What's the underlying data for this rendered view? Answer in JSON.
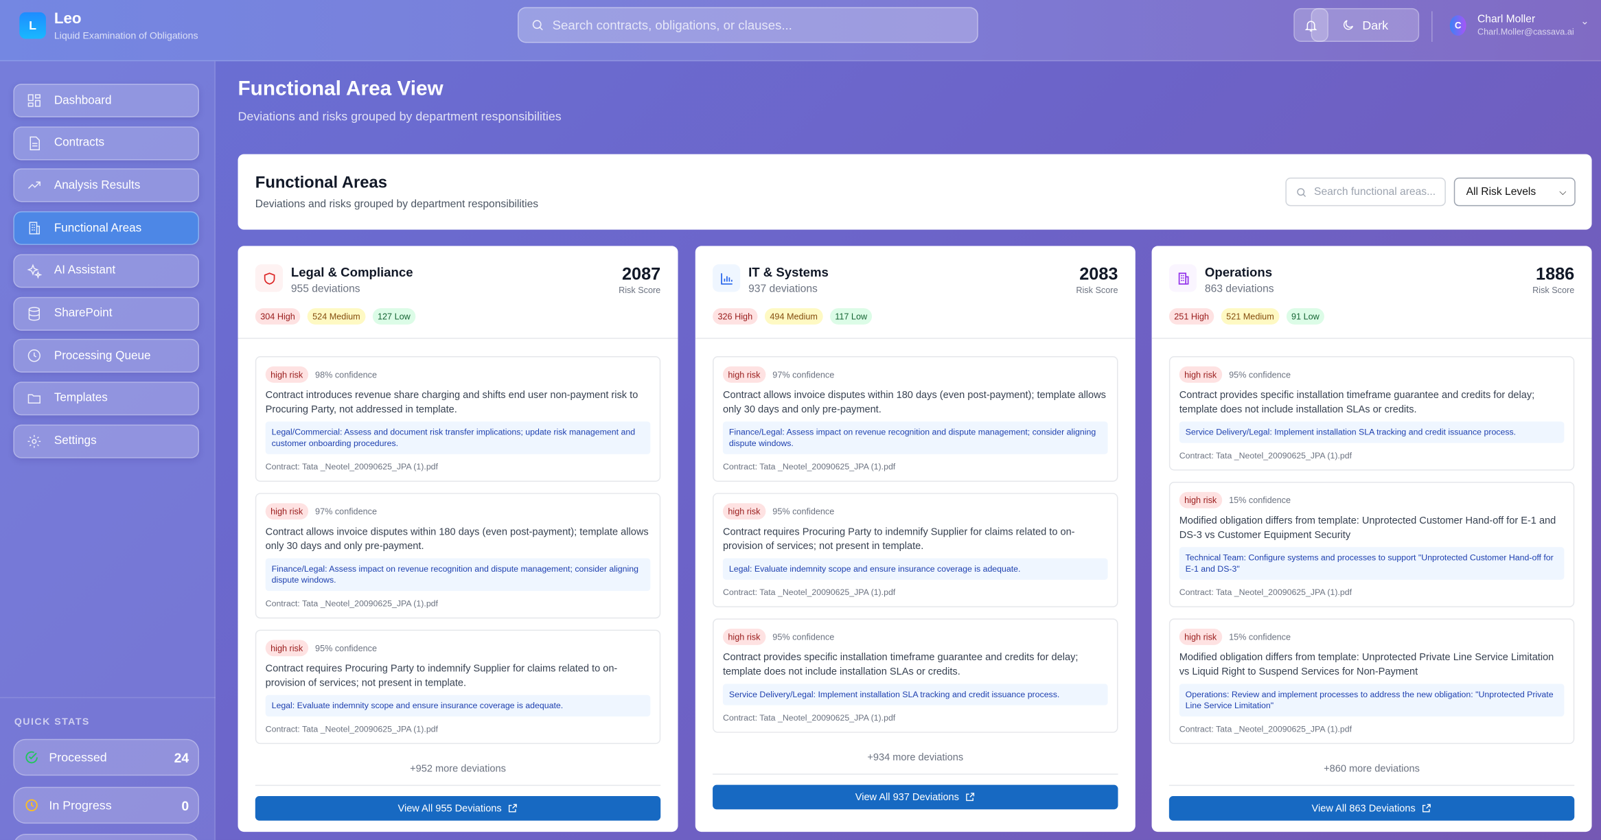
{
  "header": {
    "logo_letter": "L",
    "app_name": "Leo",
    "app_subtitle": "Liquid Examination of Obligations",
    "search_placeholder": "Search contracts, obligations, or clauses...",
    "theme_label": "Dark",
    "user_initial": "C",
    "user_name": "Charl Moller",
    "user_email": "Charl.Moller@cassava.ai"
  },
  "sidebar": {
    "items": [
      {
        "label": "Dashboard"
      },
      {
        "label": "Contracts"
      },
      {
        "label": "Analysis Results"
      },
      {
        "label": "Functional Areas"
      },
      {
        "label": "AI Assistant"
      },
      {
        "label": "SharePoint"
      },
      {
        "label": "Processing Queue"
      },
      {
        "label": "Templates"
      },
      {
        "label": "Settings"
      }
    ],
    "quick_stats_label": "QUICK STATS",
    "stats": [
      {
        "label": "Processed",
        "value": "24"
      },
      {
        "label": "In Progress",
        "value": "0"
      }
    ]
  },
  "page": {
    "title": "Functional Area View",
    "subtitle": "Deviations and risks grouped by department responsibilities"
  },
  "panel": {
    "title": "Functional Areas",
    "subtitle": "Deviations and risks grouped by department responsibilities",
    "search_placeholder": "Search functional areas...",
    "risk_filter": "All Risk Levels"
  },
  "areas": [
    {
      "name": "Legal & Compliance",
      "deviations": "955 deviations",
      "score": "2087",
      "score_label": "Risk Score",
      "high": "304 High",
      "medium": "524 Medium",
      "low": "127 Low",
      "color": "#dc2626",
      "items": [
        {
          "tag": "high risk",
          "confidence": "98% confidence",
          "desc": "Contract introduces revenue share charging and shifts end user non-payment risk to Procuring Party, not addressed in template.",
          "action": "Legal/Commercial: Assess and document risk transfer implications; update risk management and customer onboarding procedures.",
          "file": "Contract: Tata _Neotel_20090625_JPA (1).pdf"
        },
        {
          "tag": "high risk",
          "confidence": "97% confidence",
          "desc": "Contract allows invoice disputes within 180 days (even post-payment); template allows only 30 days and only pre-payment.",
          "action": "Finance/Legal: Assess impact on revenue recognition and dispute management; consider aligning dispute windows.",
          "file": "Contract: Tata _Neotel_20090625_JPA (1).pdf"
        },
        {
          "tag": "high risk",
          "confidence": "95% confidence",
          "desc": "Contract requires Procuring Party to indemnify Supplier for claims related to on-provision of services; not present in template.",
          "action": "Legal: Evaluate indemnity scope and ensure insurance coverage is adequate.",
          "file": "Contract: Tata _Neotel_20090625_JPA (1).pdf"
        }
      ],
      "more": "+952 more deviations",
      "button": "View All 955 Deviations"
    },
    {
      "name": "IT & Systems",
      "deviations": "937 deviations",
      "score": "2083",
      "score_label": "Risk Score",
      "high": "326 High",
      "medium": "494 Medium",
      "low": "117 Low",
      "color": "#2563eb",
      "items": [
        {
          "tag": "high risk",
          "confidence": "97% confidence",
          "desc": "Contract allows invoice disputes within 180 days (even post-payment); template allows only 30 days and only pre-payment.",
          "action": "Finance/Legal: Assess impact on revenue recognition and dispute management; consider aligning dispute windows.",
          "file": "Contract: Tata _Neotel_20090625_JPA (1).pdf"
        },
        {
          "tag": "high risk",
          "confidence": "95% confidence",
          "desc": "Contract requires Procuring Party to indemnify Supplier for claims related to on-provision of services; not present in template.",
          "action": "Legal: Evaluate indemnity scope and ensure insurance coverage is adequate.",
          "file": "Contract: Tata _Neotel_20090625_JPA (1).pdf"
        },
        {
          "tag": "high risk",
          "confidence": "95% confidence",
          "desc": "Contract provides specific installation timeframe guarantee and credits for delay; template does not include installation SLAs or credits.",
          "action": "Service Delivery/Legal: Implement installation SLA tracking and credit issuance process.",
          "file": "Contract: Tata _Neotel_20090625_JPA (1).pdf"
        }
      ],
      "more": "+934 more deviations",
      "button": "View All 937 Deviations"
    },
    {
      "name": "Operations",
      "deviations": "863 deviations",
      "score": "1886",
      "score_label": "Risk Score",
      "high": "251 High",
      "medium": "521 Medium",
      "low": "91 Low",
      "color": "#9333ea",
      "items": [
        {
          "tag": "high risk",
          "confidence": "95% confidence",
          "desc": "Contract provides specific installation timeframe guarantee and credits for delay; template does not include installation SLAs or credits.",
          "action": "Service Delivery/Legal: Implement installation SLA tracking and credit issuance process.",
          "file": "Contract: Tata _Neotel_20090625_JPA (1).pdf"
        },
        {
          "tag": "high risk",
          "confidence": "15% confidence",
          "desc": "Modified obligation differs from template: Unprotected Customer Hand-off for E-1 and DS-3 vs Customer Equipment Security",
          "action": "Technical Team: Configure systems and processes to support \"Unprotected Customer Hand-off for E-1 and DS-3\"",
          "file": "Contract: Tata _Neotel_20090625_JPA (1).pdf"
        },
        {
          "tag": "high risk",
          "confidence": "15% confidence",
          "desc": "Modified obligation differs from template: Unprotected Private Line Service Limitation vs Liquid Right to Suspend Services for Non-Payment",
          "action": "Operations: Review and implement processes to address the new obligation: \"Unprotected Private Line Service Limitation\"",
          "file": "Contract: Tata _Neotel_20090625_JPA (1).pdf"
        }
      ],
      "more": "+860 more deviations",
      "button": "View All 863 Deviations"
    }
  ]
}
